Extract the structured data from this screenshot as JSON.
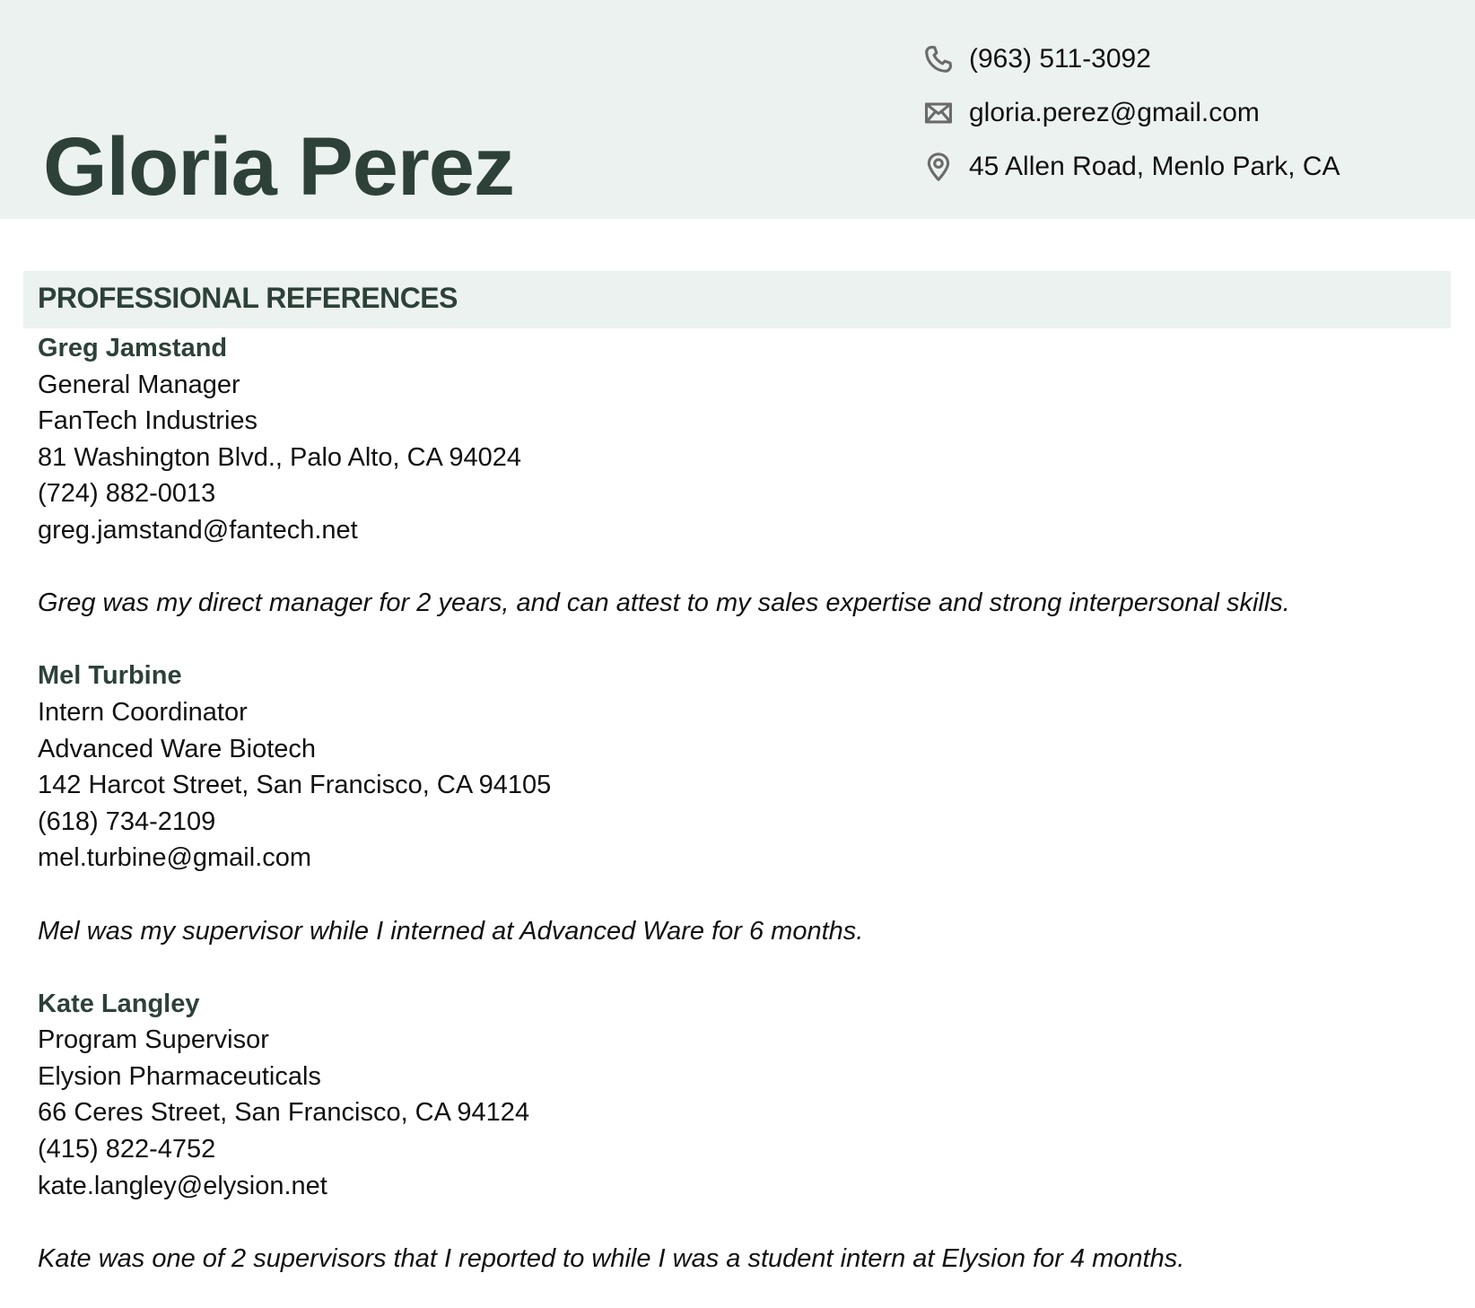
{
  "header": {
    "name": "Gloria Perez",
    "contact": [
      {
        "icon": "phone-icon",
        "text": "(963) 511-3092"
      },
      {
        "icon": "mail-icon",
        "text": "gloria.perez@gmail.com"
      },
      {
        "icon": "location-pin-icon",
        "text": "45 Allen Road, Menlo Park, CA"
      }
    ]
  },
  "section": {
    "title": "PROFESSIONAL REFERENCES"
  },
  "references": [
    {
      "name": "Greg Jamstand",
      "title": "General Manager",
      "company": "FanTech Industries",
      "address": "81 Washington Blvd., Palo Alto, CA 94024",
      "phone": "(724) 882-0013",
      "email": "greg.jamstand@fantech.net",
      "note": "Greg was my direct manager for 2 years, and can attest to my sales expertise and strong interpersonal skills."
    },
    {
      "name": "Mel Turbine",
      "title": "Intern Coordinator",
      "company": "Advanced Ware Biotech",
      "address": "142 Harcot Street, San Francisco, CA 94105",
      "phone": "(618) 734-2109",
      "email": "mel.turbine@gmail.com",
      "note": "Mel was my supervisor while I interned at Advanced Ware for 6 months."
    },
    {
      "name": "Kate Langley",
      "title": "Program Supervisor",
      "company": "Elysion Pharmaceuticals",
      "address": "66 Ceres Street, San Francisco, CA 94124",
      "phone": "(415) 822-4752",
      "email": "kate.langley@elysion.net",
      "note": "Kate was one of 2 supervisors that I reported to while I was a student intern at Elysion for 4 months."
    }
  ],
  "colors": {
    "accent": "#2D4139",
    "band": "#ECF2EF",
    "icon": "#6B6B6B"
  }
}
